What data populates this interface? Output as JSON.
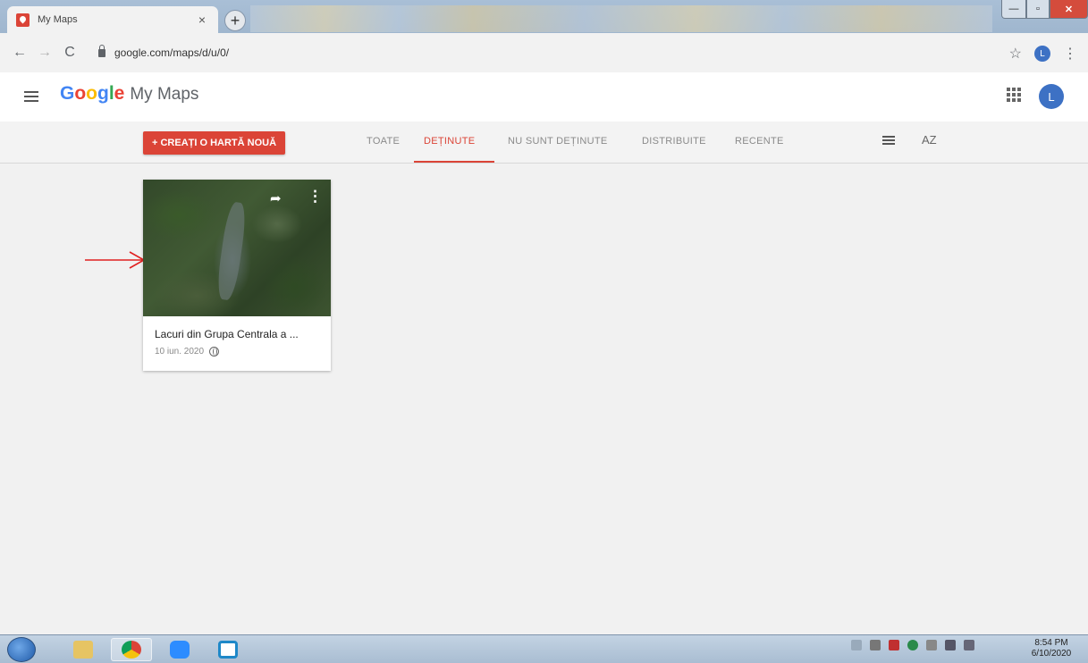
{
  "browser": {
    "tab_title": "My Maps",
    "tab_close": "×",
    "new_tab": "+",
    "url": "google.com/maps/d/u/0/",
    "profile_initial": "L",
    "window_min": "—",
    "window_max": "▫",
    "window_close": "✕"
  },
  "app": {
    "brand_google": [
      "G",
      "o",
      "o",
      "g",
      "l",
      "e"
    ],
    "brand_colors": [
      "#4285f4",
      "#ea4335",
      "#fbbc05",
      "#4285f4",
      "#34a853",
      "#ea4335"
    ],
    "product": "My Maps",
    "avatar_initial": "L"
  },
  "toolbar": {
    "create_label": "+ CREAȚI O HARTĂ NOUĂ",
    "tabs": [
      {
        "label": "TOATE",
        "active": false
      },
      {
        "label": "DEȚINUTE",
        "active": true
      },
      {
        "label": "NU SUNT DEȚINUTE",
        "active": false
      },
      {
        "label": "DISTRIBUITE",
        "active": false
      },
      {
        "label": "RECENTE",
        "active": false
      }
    ],
    "sort_label": "AZ",
    "accent_color": "#db4437"
  },
  "maps": [
    {
      "title": "Lacuri din Grupa Centrala a ...",
      "date": "10 iun. 2020",
      "visibility_icon": "public-globe-icon"
    }
  ],
  "taskbar": {
    "clock_time": "8:54 PM",
    "clock_date": "6/10/2020"
  }
}
